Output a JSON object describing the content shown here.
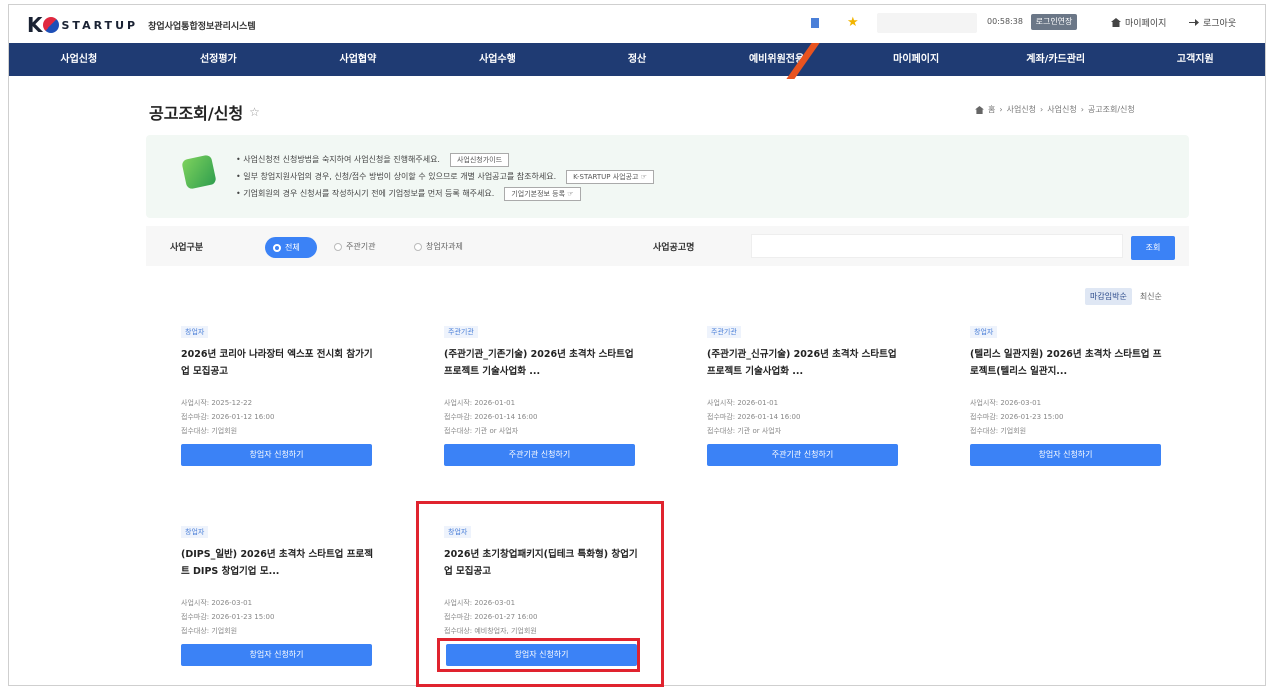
{
  "header": {
    "logo_k": "K",
    "logo_startup": "STARTUP",
    "logo_subtitle": "창업사업통합정보관리시스템",
    "timer": "00:58:38",
    "extend_label": "로그인연장",
    "mypage_label": "마이페이지",
    "logout_label": "로그아웃"
  },
  "nav": {
    "items": [
      "사업신청",
      "선정평가",
      "사업협약",
      "사업수행",
      "정산",
      "예비위원전용",
      "마이페이지",
      "계좌/카드관리",
      "고객지원"
    ]
  },
  "page": {
    "title": "공고조회/신청",
    "breadcrumb": [
      "홈",
      "사업신청",
      "사업신청",
      "공고조회/신청"
    ]
  },
  "notice": {
    "lines": [
      {
        "text": "• 사업신청전 신청방법을 숙지하여 사업신청을 진행해주세요.",
        "button": "사업신청가이드"
      },
      {
        "text": "• 일부 창업지원사업의 경우, 신청/접수 방법이 상이할 수 있으므로 개별 사업공고를 참조하세요.",
        "button": "K-STARTUP 사업공고 ☞"
      },
      {
        "text": "• 기업회원의 경우 신청서를 작성하시기 전에 기업정보를 먼저 등록 해주세요.",
        "button": "기업기본정보 등록 ☞"
      }
    ]
  },
  "filter": {
    "category_label": "사업구분",
    "options": [
      "전체",
      "주관기관",
      "창업자과제"
    ],
    "selected": "전체",
    "name_label": "사업공고명",
    "search_button": "조회"
  },
  "sort": {
    "options": [
      "마감임박순",
      "최신순"
    ],
    "selected": "마감임박순"
  },
  "cards": [
    {
      "tag": "창업자",
      "title": "2026년 코리아 나라장터 엑스포 전시회 참가기업 모집공고",
      "start": "사업시작: 2025-12-22",
      "deadline": "접수마감: 2026-01-12 16:00",
      "target": "접수대상: 기업회원",
      "button": "창업자 신청하기"
    },
    {
      "tag": "주관기관",
      "title": "(주관기관_기존기술) 2026년 초격차 스타트업 프로젝트 기술사업화 ...",
      "start": "사업시작: 2026-01-01",
      "deadline": "접수마감: 2026-01-14 16:00",
      "target": "접수대상: 기관 or 사업자",
      "button": "주관기관 신청하기"
    },
    {
      "tag": "주관기관",
      "title": "(주관기관_신규기술) 2026년 초격차 스타트업 프로젝트 기술사업화 ...",
      "start": "사업시작: 2026-01-01",
      "deadline": "접수마감: 2026-01-14 16:00",
      "target": "접수대상: 기관 or 사업자",
      "button": "주관기관 신청하기"
    },
    {
      "tag": "창업자",
      "title": "(텔리스 일관지원) 2026년 초격차 스타트업 프로젝트(텔리스 일관지...",
      "start": "사업시작: 2026-03-01",
      "deadline": "접수마감: 2026-01-23 15:00",
      "target": "접수대상: 기업회원",
      "button": "창업자 신청하기"
    },
    {
      "tag": "창업자",
      "title": "(DIPS_일반) 2026년 초격차 스타트업 프로젝트 DIPS 창업기업 모...",
      "start": "사업시작: 2026-03-01",
      "deadline": "접수마감: 2026-01-23 15:00",
      "target": "접수대상: 기업회원",
      "button": "창업자 신청하기"
    },
    {
      "tag": "창업자",
      "title": "2026년 초기창업패키지(딥테크 특화형) 창업기업 모집공고",
      "start": "사업시작: 2026-03-01",
      "deadline": "접수마감: 2026-01-27 16:00",
      "target": "접수대상: 예비창업자, 기업회원",
      "button": "창업자 신청하기"
    }
  ]
}
